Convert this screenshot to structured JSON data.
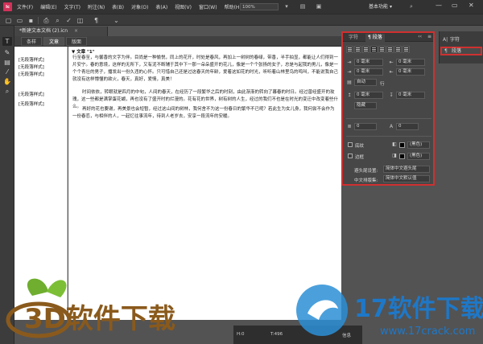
{
  "app": {
    "logo_text": "Ic",
    "menu": [
      "文件(F)",
      "编辑(E)",
      "文字(T)",
      "附注(N)",
      "表(B)",
      "对象(O)",
      "表(A)",
      "视图(V)",
      "窗口(W)",
      "帮助(H)"
    ],
    "zoom": "100%",
    "workspace": "基本功能",
    "workspace_arrow": "▾",
    "window_controls": [
      "—",
      "▭",
      "✕"
    ]
  },
  "document": {
    "tab_title": "*新建文本文档 (2).icn",
    "tab_close": "×",
    "view_tabs": [
      "条样",
      "文章",
      "版面"
    ],
    "story_header": "▼ 文章 \"1\"",
    "style_tags": [
      "[无段落样式]",
      "[无段落样式]",
      "[无段落样式]",
      "[无段落样式]",
      "[无段落样式]"
    ],
    "paragraphs": [
      "行至春至，与馨香的文字为伴。目尚是一种愉悦，同上的花开，时处是春风，再加上一树树的春绿，带香，半手拍显，都能让人们得到一片安宁。春的意境，这样的无所下，又有泥不断辅于其中下一那一朵朵盛开的花儿，像是一个个张扬的女子，总是与起我的男儿，像是一个个青壮的男子，播发出一份久违的心怀。只可惜自己还是过这春天的年龄，爱着这如花的时光，听听着山林里鸟的鸣叫，不能说我自己就没有这样懵懂的欲火，春天，真好，爱情，真美！",
      "时间依依，转眼就是四月的中旬，人间的春天，在经历了一段繁华之后的时刻，由此渐渐的转向了暮春的时日。经过曾经盛开的玫瑰，这一些都是满掌蛋花蝴，再也没有了盛开时的烂漫的。花有花的世界，树有树的人生，经过的我们不也是在时光的变迁中改变着些什么。",
      "再好的花也要谢，再美景也会短暂，经过这山间的树林，我何舍不为这一份春日的繁华不已呢？若此生为女儿身，我何尝不会作为一份春恋，与相伴的人，一起忆往事流年，待到人老岁去，安享一段流年的安暖。"
    ],
    "status": {
      "left": "H:0",
      "mid": "T:496",
      "right": "信息"
    }
  },
  "panel": {
    "tabs": [
      "字符",
      "段落"
    ],
    "menu_glyph": "≡",
    "collapse_glyph": "‹‹",
    "indent_left": "0 毫米",
    "indent_right": "0 毫米",
    "first_indent": "0 毫米",
    "last_indent": "0 毫米",
    "auto_label": "自动",
    "line_label": "行",
    "space_before": "0 毫米",
    "space_after": "0 毫米",
    "kinsoku_label": "隐藏",
    "drop_lines": "0",
    "drop_chars": "0",
    "shading_label": "底纹",
    "border_label": "边框",
    "color_label": "(黑色)",
    "kinsoku_set_label": "避头尾设置:",
    "kinsoku_set_value": "简体中文避头尾",
    "spacing_label": "中文排版集:",
    "spacing_value": "简体中文默认值",
    "accent_color": "#d03030"
  },
  "dock": {
    "items": [
      "字符",
      "段落"
    ]
  },
  "watermarks": {
    "left_text": "3D软件下载",
    "right_text": "17软件下载",
    "right_url": "www.17crack.com"
  }
}
